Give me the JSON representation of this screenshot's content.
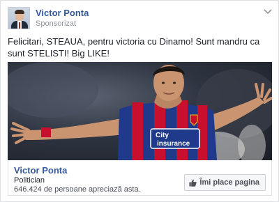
{
  "post": {
    "page_name": "Victor Ponta",
    "sponsored_label": "Sponsorizat",
    "text": "Felicitari, STEAUA, pentru victoria cu Dinamo! Sunt mandru ca sunt STELISTI! Big LIKE!",
    "menu_icon": "chevron-down-icon",
    "photo": {
      "jersey_sponsor_line1": "City",
      "jersey_sponsor_line2": "insurance"
    }
  },
  "footer": {
    "page_name": "Victor Ponta",
    "category": "Politician",
    "likes_text": "646.424 de persoane apreciază asta.",
    "like_button_label": "Îmi place pagina",
    "like_icon": "thumbs-up-icon"
  },
  "colors": {
    "link_blue": "#365899",
    "secondary_text": "#90949c",
    "jersey_red": "#c8102e",
    "jersey_blue": "#1f3a8a"
  }
}
